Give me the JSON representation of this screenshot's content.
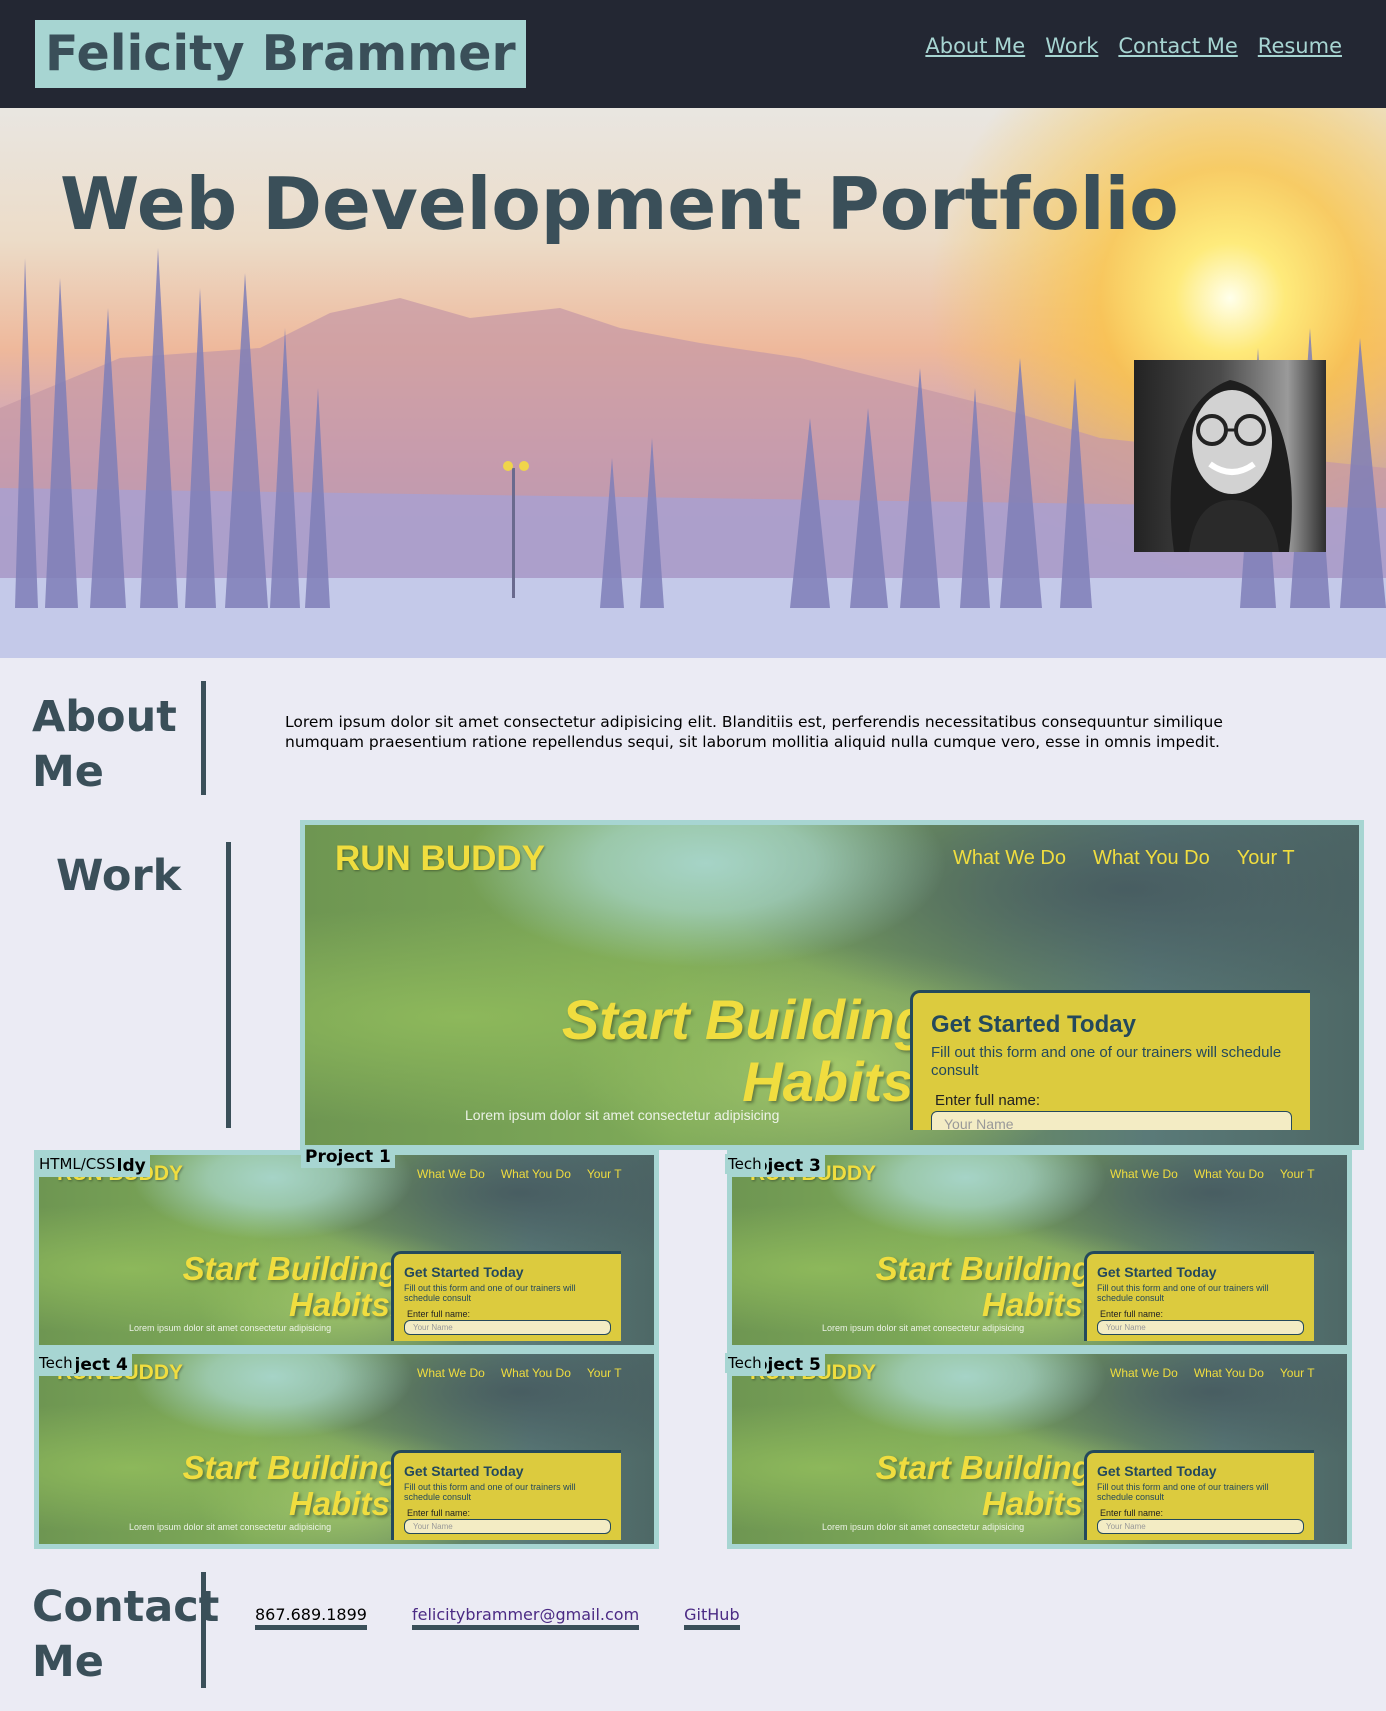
{
  "header": {
    "brand": "Felicity Brammer",
    "nav": [
      "About Me",
      "Work",
      "Contact Me",
      "Resume"
    ]
  },
  "hero": {
    "title": "Web Development Portfolio"
  },
  "about": {
    "heading": "About Me",
    "text": "Lorem ipsum dolor sit amet consectetur adipisicing elit. Blanditiis est, perferendis necessitatibus consequuntur similique numquam praesentium ratione repellendus sequi, sit laborum mollitia aliquid nulla cumque vero, esse in omnis impedit."
  },
  "work": {
    "heading": "Work",
    "screenshot": {
      "brand": "RUN BUDDY",
      "nav": [
        "What We Do",
        "What You Do",
        "Your T"
      ],
      "headline_line1": "Start Building",
      "headline_line2": "Habits.",
      "lorem": "Lorem ipsum dolor sit amet consectetur adipisicing",
      "form_title": "Get Started Today",
      "form_desc": "Fill out this form and one of our trainers will schedule consult",
      "form_label": "Enter full name:",
      "form_placeholder": "Your Name"
    },
    "projects": [
      {
        "name": "Project 1",
        "tech": ""
      },
      {
        "name": "Run Buddy",
        "tech": "HTML/CSS"
      },
      {
        "name": "Project 3",
        "tech": "Tech"
      },
      {
        "name": "Project 4",
        "tech": "Tech"
      },
      {
        "name": "Project 5",
        "tech": "Tech"
      }
    ]
  },
  "contact": {
    "heading": "Contact Me",
    "phone": "867.689.1899",
    "email": "felicitybrammer@gmail.com",
    "github": "GitHub"
  },
  "colors": {
    "header_bg": "#232733",
    "accent": "#a7d5d2",
    "heading_text": "#3a4f59",
    "page_bg": "#ebebf4",
    "runbuddy_yellow": "#f0dd3f"
  }
}
